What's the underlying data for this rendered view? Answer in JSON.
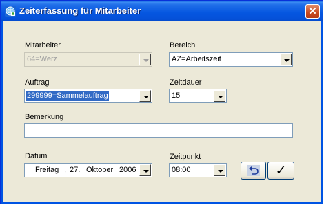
{
  "window": {
    "title": "Zeiterfassung für Mitarbeiter",
    "close_glyph": "✕"
  },
  "fields": {
    "mitarbeiter": {
      "label": "Mitarbeiter",
      "value": "64=Werz",
      "disabled": true
    },
    "bereich": {
      "label": "Bereich",
      "value": "AZ=Arbeitszeit"
    },
    "auftrag": {
      "label": "Auftrag",
      "value": "299999=Sammelauftrag"
    },
    "zeitdauer": {
      "label": "Zeitdauer",
      "value": "15"
    },
    "bemerkung": {
      "label": "Bemerkung",
      "value": ""
    },
    "datum": {
      "label": "Datum",
      "weekday": "Freitag",
      "separator": ",",
      "day": "27.",
      "month": "Oktober",
      "year": "2006"
    },
    "zeitpunkt": {
      "label": "Zeitpunkt",
      "value": "08:00"
    }
  },
  "buttons": {
    "undo": {
      "icon": "undo-icon"
    },
    "confirm": {
      "icon": "checkmark-icon",
      "glyph": "✓"
    }
  },
  "colors": {
    "titlebar": "#0556e0",
    "selection": "#316ac5",
    "dialog_bg": "#ece9d8"
  }
}
